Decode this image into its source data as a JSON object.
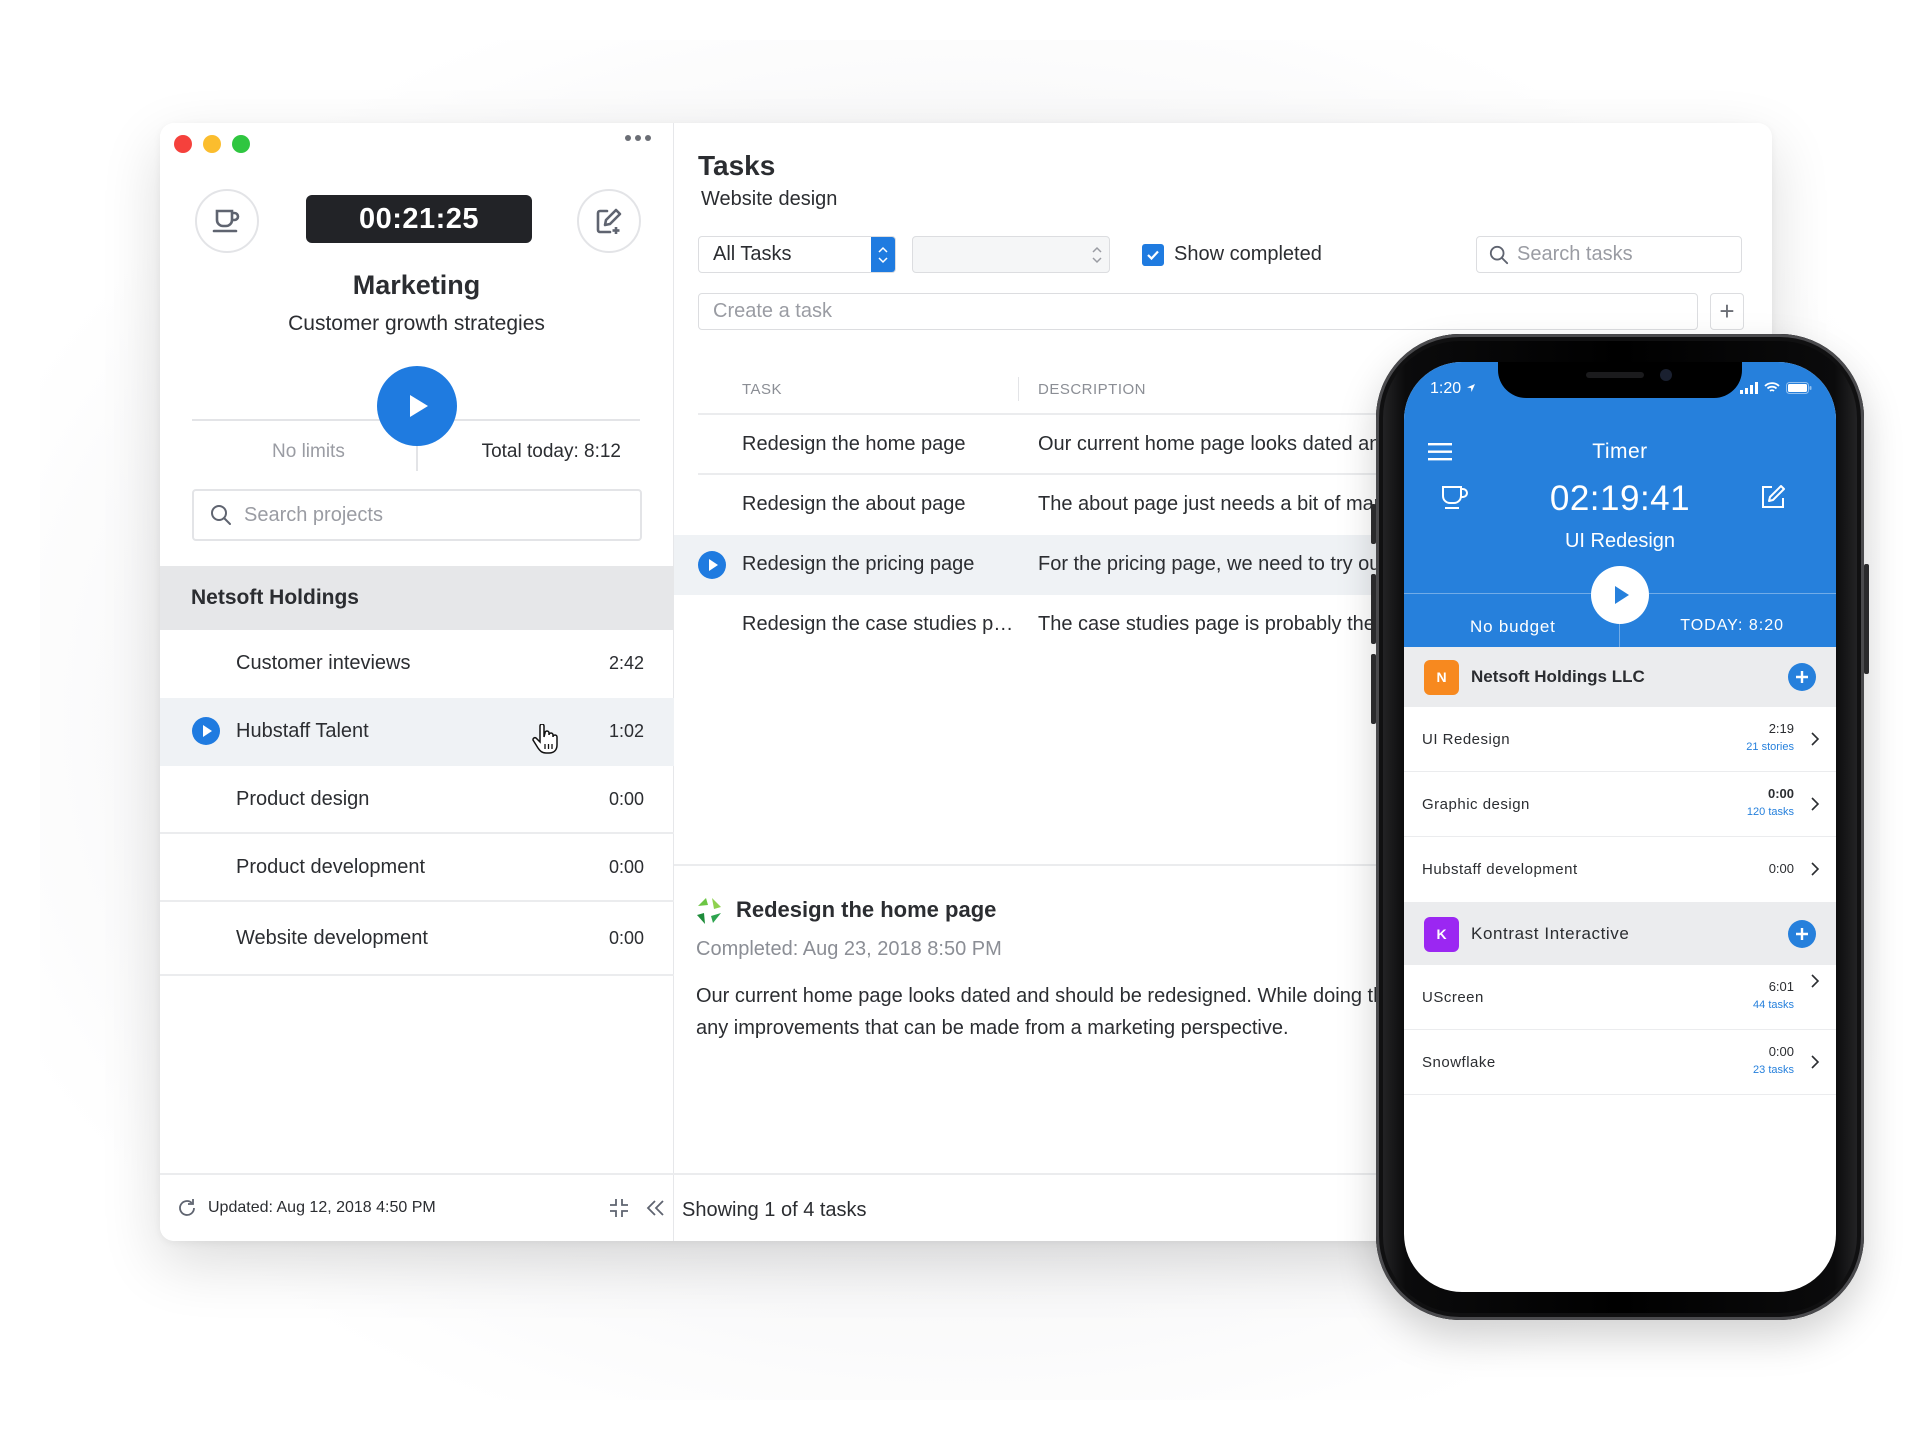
{
  "desktop": {
    "sidebar": {
      "timer": "00:21:25",
      "project_title": "Marketing",
      "project_subtitle": "Customer growth strategies",
      "limits_label": "No limits",
      "total_today": "Total today: 8:12",
      "search_placeholder": "Search projects",
      "organization": "Netsoft Holdings",
      "projects": [
        {
          "name": "Customer inteviews",
          "time": "2:42",
          "active": false
        },
        {
          "name": "Hubstaff Talent",
          "time": "1:02",
          "active": true
        },
        {
          "name": "Product design",
          "time": "0:00",
          "active": false
        },
        {
          "name": "Product development",
          "time": "0:00",
          "active": false
        },
        {
          "name": "Website development",
          "time": "0:00",
          "active": false
        }
      ],
      "footer_updated": "Updated: Aug 12, 2018 4:50 PM"
    },
    "main": {
      "title": "Tasks",
      "subtitle": "Website design",
      "filter_select": "All Tasks",
      "second_select": "",
      "show_completed_label": "Show completed",
      "show_completed_checked": true,
      "search_placeholder": "Search tasks",
      "create_placeholder": "Create a task",
      "add_label": "+",
      "columns": {
        "task": "TASK",
        "description": "DESCRIPTION"
      },
      "tasks": [
        {
          "name": "Redesign the home page",
          "description": "Our current home page looks dated and should be redesigned.",
          "active": false
        },
        {
          "name": "Redesign the about page",
          "description": "The about page just needs a bit of marketing love.",
          "active": false
        },
        {
          "name": "Redesign the pricing page",
          "description": "For the pricing page, we need to try out new options.",
          "active": true
        },
        {
          "name": "Redesign the case studies pa…",
          "description": "The case studies page is probably the most important.",
          "active": false
        }
      ],
      "detail": {
        "title": "Redesign the home page",
        "completed": "Completed: Aug 23, 2018 8:50 PM",
        "body": "Our current home page looks dated and should be redesigned. While doing this, review each section and see if there are any improvements that can be made from a marketing perspective."
      },
      "footer_showing": "Showing 1 of 4 tasks"
    }
  },
  "phone": {
    "status_time": "1:20",
    "title": "Timer",
    "timer": "02:19:41",
    "project": "UI Redesign",
    "budget_label": "No budget",
    "today_label": "TODAY: 8:20",
    "organizations": [
      {
        "badge": "N",
        "badge_color": "#f7891f",
        "name": "Netsoft Holdings LLC",
        "projects": [
          {
            "name": "UI Redesign",
            "time": "2:19",
            "sub": "21 stories"
          },
          {
            "name": "Graphic design",
            "time": "0:00",
            "sub": "120 tasks"
          },
          {
            "name": "Hubstaff development",
            "time": "0:00",
            "sub": ""
          }
        ]
      },
      {
        "badge": "K",
        "badge_color": "#9b27f2",
        "name": "Kontrast Interactive",
        "projects": [
          {
            "name": "UScreen",
            "time": "6:01",
            "sub": "44 tasks"
          },
          {
            "name": "Snowflake",
            "time": "0:00",
            "sub": "23 tasks"
          }
        ]
      }
    ]
  },
  "colors": {
    "accent": "#1f7be0",
    "phone_header": "#2680dc",
    "timer_bg": "#222327"
  }
}
